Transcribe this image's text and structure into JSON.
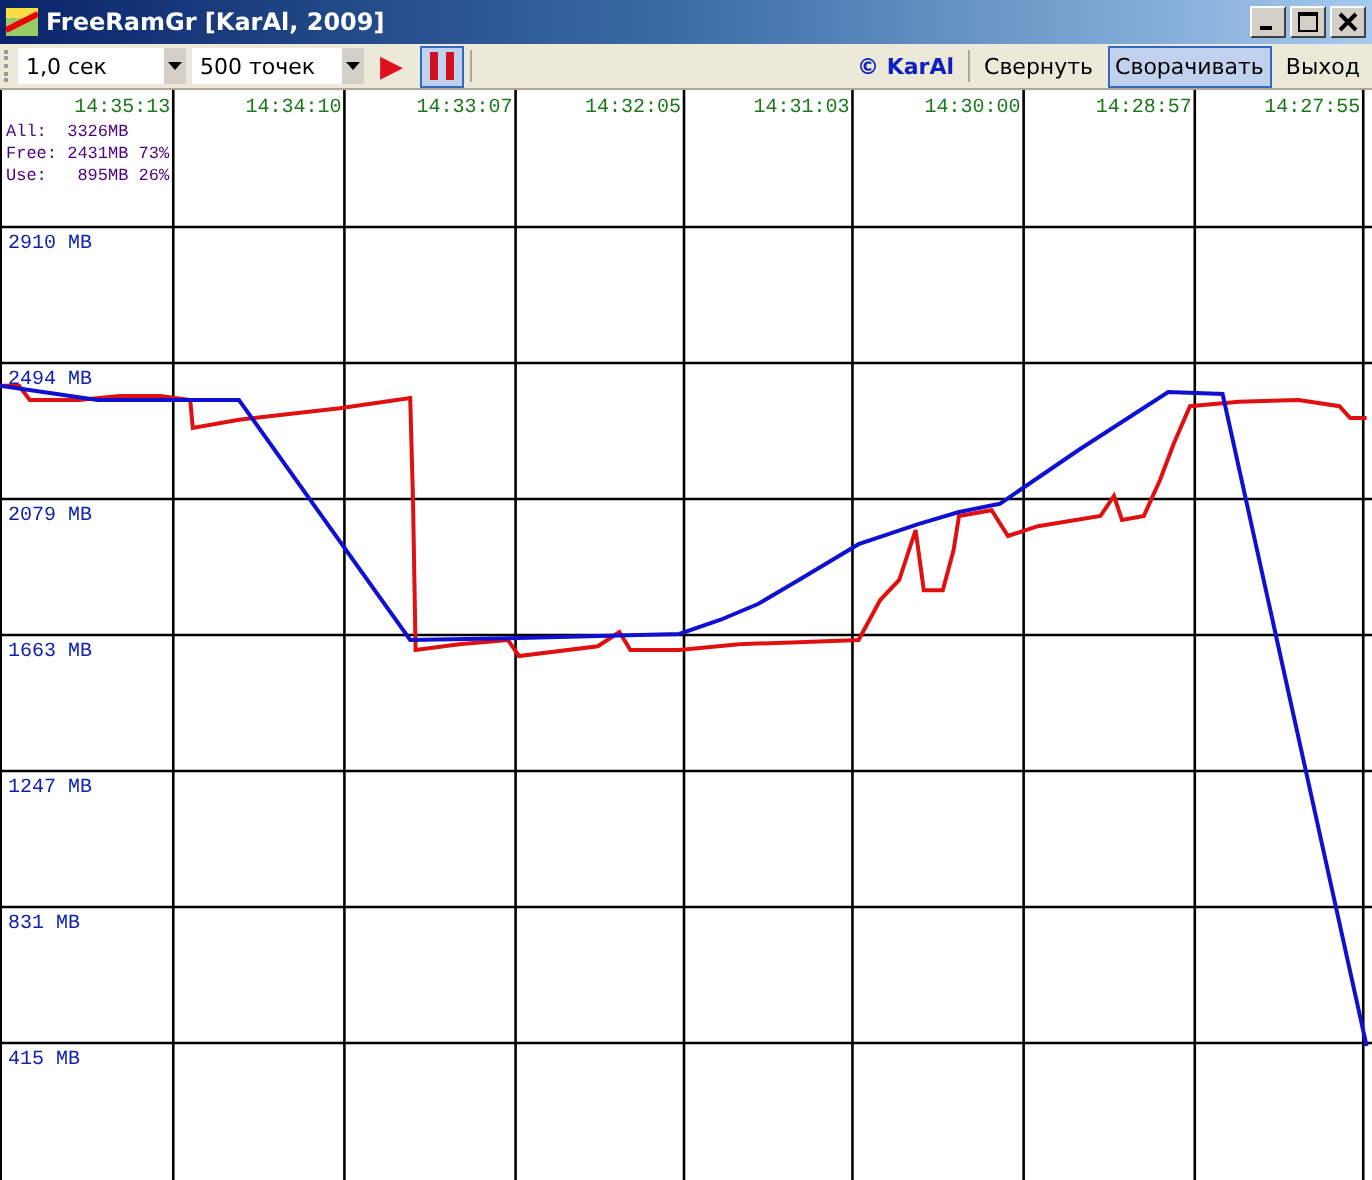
{
  "window": {
    "title": "FreeRamGr [KarAl, 2009]"
  },
  "toolbar": {
    "interval": "1,0 сек",
    "points": "500 точек",
    "play": "▶",
    "pause_pressed": true,
    "credit": "© KarAl",
    "buttons": [
      {
        "label": "Свернуть",
        "selected": false
      },
      {
        "label": "Сворачивать",
        "selected": true
      },
      {
        "label": "Выход",
        "selected": false
      }
    ]
  },
  "info": [
    "All:  3326MB",
    "Free: 2431MB 73%",
    "Use:   895MB 26%"
  ],
  "chart": {
    "chart_data": {
      "type": "line",
      "grid": true,
      "xlim": [
        52558,
        52053
      ],
      "ylim": [
        -8,
        3326
      ],
      "xticks": [
        {
          "value": 52513,
          "label": "14:35:13"
        },
        {
          "value": 52450,
          "label": "14:34:10"
        },
        {
          "value": 52387,
          "label": "14:33:07"
        },
        {
          "value": 52325,
          "label": "14:32:05"
        },
        {
          "value": 52263,
          "label": "14:31:03"
        },
        {
          "value": 52200,
          "label": "14:30:00"
        },
        {
          "value": 52137,
          "label": "14:28:57"
        },
        {
          "value": 52075,
          "label": "14:27:55"
        }
      ],
      "yticks": [
        {
          "value": 2910,
          "label": "2910 MB"
        },
        {
          "value": 2494,
          "label": "2494 MB"
        },
        {
          "value": 2079,
          "label": "2079 MB"
        },
        {
          "value": 1663,
          "label": "1663 MB"
        },
        {
          "value": 1247,
          "label": "1247 MB"
        },
        {
          "value": 831,
          "label": "831 MB"
        },
        {
          "value": 415,
          "label": "415 MB"
        }
      ],
      "series": [
        {
          "color": "#e01010",
          "x": [
            52558,
            52551,
            52547,
            52529,
            52514,
            52499,
            52488,
            52487,
            52470,
            52433,
            52407,
            52406,
            52405,
            52389,
            52371,
            52367,
            52338,
            52330,
            52326,
            52308,
            52286,
            52264,
            52242,
            52234,
            52227,
            52221,
            52218,
            52211,
            52207,
            52205,
            52193,
            52187,
            52176,
            52153,
            52148,
            52145,
            52137,
            52131,
            52126,
            52120,
            52102,
            52080,
            52065,
            52061,
            52055
          ],
          "values": [
            2421,
            2421,
            2378,
            2378,
            2390,
            2390,
            2378,
            2292,
            2317,
            2353,
            2384,
            2072,
            1613,
            1631,
            1644,
            1595,
            1625,
            1668,
            1613,
            1613,
            1631,
            1637,
            1644,
            1766,
            1827,
            1980,
            1796,
            1796,
            1919,
            2023,
            2041,
            1962,
            1992,
            2023,
            2084,
            2011,
            2023,
            2133,
            2243,
            2359,
            2372,
            2378,
            2359,
            2323,
            2323
          ]
        },
        {
          "color": "#1010d0",
          "x": [
            52558,
            52522,
            52488,
            52470,
            52407,
            52367,
            52308,
            52293,
            52279,
            52264,
            52242,
            52220,
            52205,
            52190,
            52161,
            52128,
            52108,
            52055
          ],
          "values": [
            2421,
            2378,
            2378,
            2378,
            1644,
            1650,
            1662,
            1705,
            1754,
            1827,
            1937,
            1998,
            2035,
            2060,
            2225,
            2402,
            2396,
            402
          ]
        }
      ]
    }
  }
}
